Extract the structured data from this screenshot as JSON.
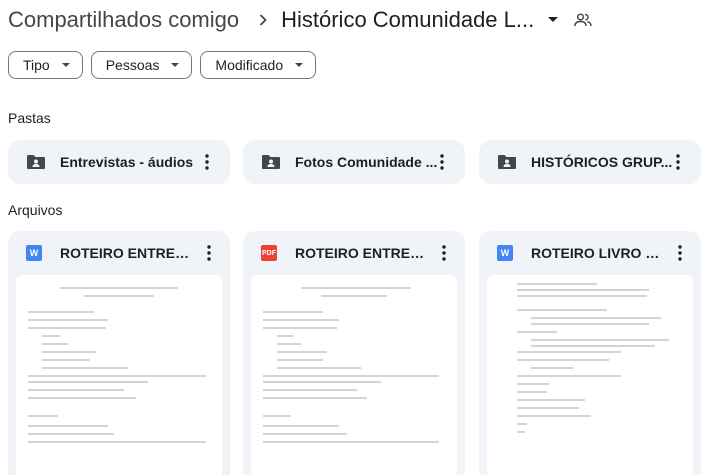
{
  "breadcrumb": {
    "root": "Compartilhados comigo",
    "current": "Histórico Comunidade L..."
  },
  "filters": [
    {
      "label": "Tipo"
    },
    {
      "label": "Pessoas"
    },
    {
      "label": "Modificado"
    }
  ],
  "sections": {
    "folders_label": "Pastas",
    "files_label": "Arquivos"
  },
  "folders": [
    {
      "name": "Entrevistas - áudios"
    },
    {
      "name": "Fotos Comunidade ..."
    },
    {
      "name": "HISTÓRICOS GRUP..."
    }
  ],
  "files": [
    {
      "name": "ROTEIRO ENTREVIS...",
      "type": "W",
      "type_color": "#4285f4"
    },
    {
      "name": "ROTEIRO ENTREVIS...",
      "type": "PDF",
      "type_color": "#ea4335"
    },
    {
      "name": "ROTEIRO LIVRO CO...",
      "type": "W",
      "type_color": "#4285f4"
    }
  ],
  "colors": {
    "card_bg": "#f0f4f9",
    "text": "#1f1f1f",
    "secondary": "#444746"
  }
}
